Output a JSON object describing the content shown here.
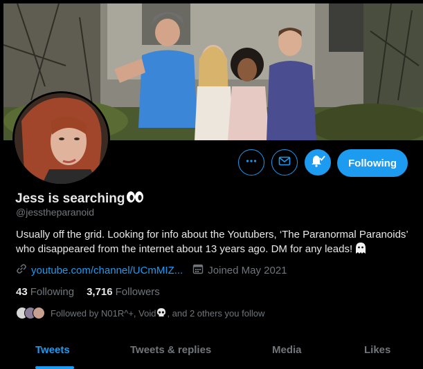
{
  "profile": {
    "display_name": "Jess is searching",
    "name_emoji": "eyes-emoji",
    "handle": "@jesstheparanoid",
    "bio": "Usually off the grid. Looking for info about the Youtubers, ‘The Paranormal Paranoids’ who disappeared from the internet about 13 years ago. DM for any leads!",
    "bio_emoji": "ghost-emoji",
    "website": "youtube.com/channel/UCmMIZ...",
    "joined": "Joined May 2021"
  },
  "stats": {
    "following_count": "43",
    "following_label": "Following",
    "followers_count": "3,716",
    "followers_label": "Followers"
  },
  "followed_by": {
    "prefix": "Followed by N01R^+, Void",
    "suffix": ", and 2 others you follow",
    "emoji": "skull-emoji"
  },
  "actions": {
    "follow_label": "Following",
    "more_icon": "more-icon",
    "message_icon": "mail-icon",
    "notify_icon": "bell-icon"
  },
  "tabs": [
    {
      "label": "Tweets",
      "active": true
    },
    {
      "label": "Tweets & replies",
      "active": false
    },
    {
      "label": "Media",
      "active": false
    },
    {
      "label": "Likes",
      "active": false
    }
  ],
  "colors": {
    "accent": "#1d9bf0",
    "background": "#000000",
    "muted": "#71767b"
  }
}
